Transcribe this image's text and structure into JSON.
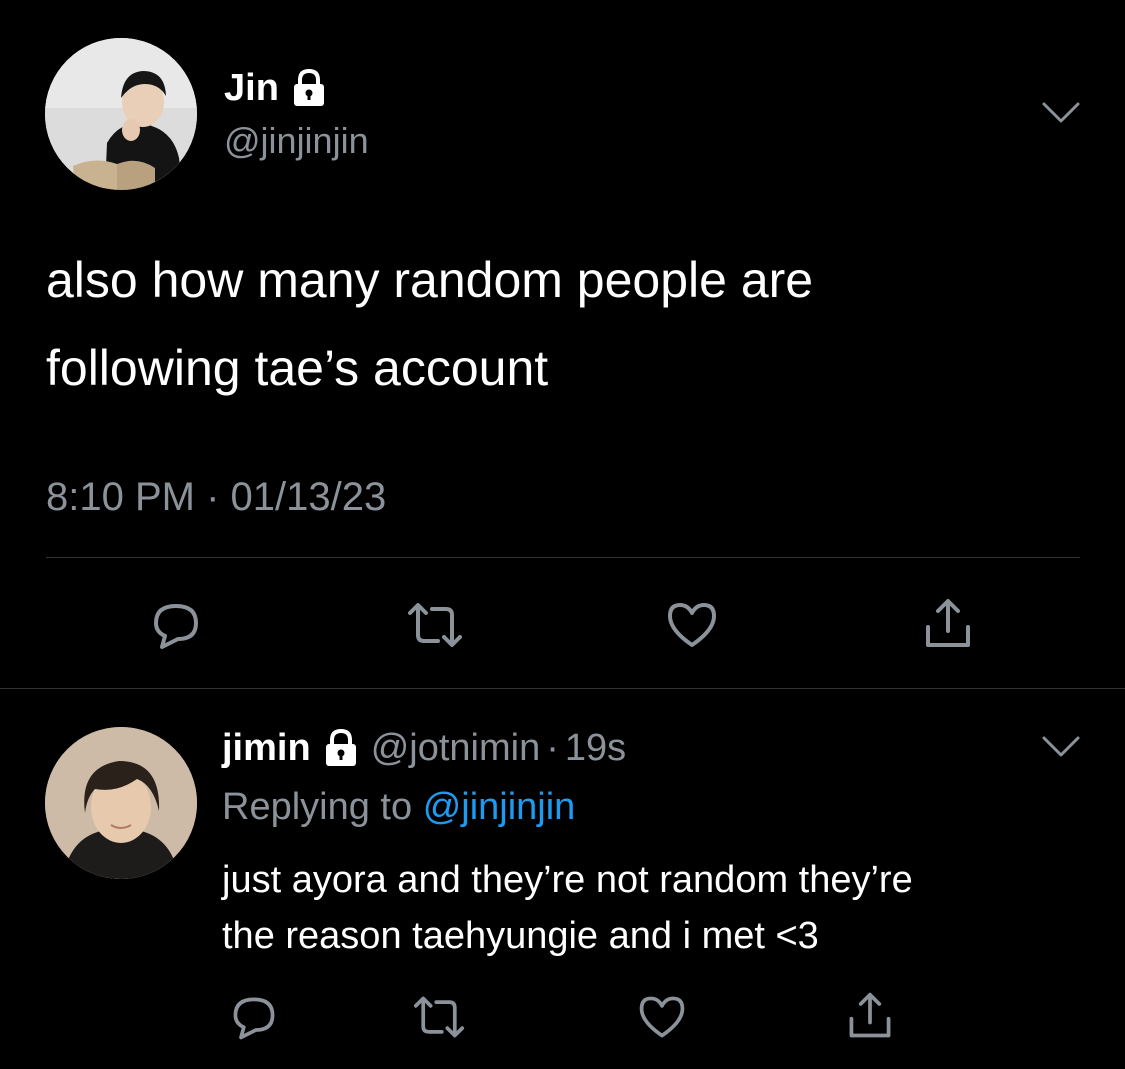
{
  "main_tweet": {
    "display_name": "Jin",
    "handle": "@jinjinjin",
    "protected_icon": "lock-icon",
    "text_line1": "also how many random people are",
    "text_line2": "following tae’s account",
    "timestamp": "8:10 PM · 01/13/23",
    "actions": [
      "reply-icon",
      "retweet-icon",
      "like-icon",
      "share-icon"
    ]
  },
  "reply_tweet": {
    "display_name": "jimin",
    "handle": "@jotnimin",
    "separator": "·",
    "time_ago": "19s",
    "replying_prefix": "Replying to",
    "replying_to": "@jinjinjin",
    "text_line1": "just ayora and they’re not random they’re",
    "text_line2": "the reason taehyungie and i met <3",
    "actions": [
      "reply-icon",
      "retweet-icon",
      "like-icon",
      "share-icon"
    ]
  },
  "colors": {
    "background": "#000000",
    "primary_text": "#ffffff",
    "secondary_text": "#8b9299",
    "link": "#1d9bf0",
    "divider": "#2f3336"
  }
}
